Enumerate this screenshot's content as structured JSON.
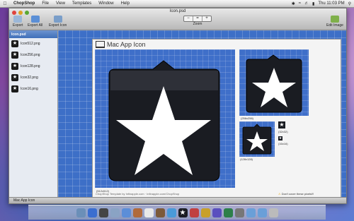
{
  "menubar": {
    "app_name": "ChopShop",
    "items": [
      "File",
      "View",
      "Templates",
      "Window",
      "Help"
    ],
    "clock": "Thu 11:03 PM"
  },
  "window": {
    "title": "Icon.psd",
    "toolbar": {
      "export": "Export",
      "export_all": "Export All",
      "export_icon": "Export Icon",
      "zoom_label": "Zoom",
      "zoom_minus": "−",
      "zoom_fit": "=",
      "zoom_plus": "+",
      "edit_image": "Edit Image"
    }
  },
  "sidebar": {
    "items": [
      {
        "label": "Icon.psd",
        "selected": true
      },
      {
        "label": "Icon512.png"
      },
      {
        "label": "Icon256.png"
      },
      {
        "label": "Icon128.png"
      },
      {
        "label": "Icon32.png"
      },
      {
        "label": "Icon16.png"
      }
    ]
  },
  "sheet": {
    "title": "Mac App Icon",
    "captions": {
      "c512": "(512x512)",
      "c256": "(256x256)",
      "c128": "(128x128)",
      "c32": "(32x32)",
      "c16": "(16x16)"
    },
    "footer_note": "ChopShop Template by Infinapple.com · Infinapple.com/ChopShop",
    "warning": "Don't cover these pixels!!!"
  },
  "statusbar": {
    "text": "Mac App Icon"
  },
  "colors": {
    "blueprint": "#3d6fc7",
    "icon_body": "#1a1c22",
    "selection": "#4f7cc3"
  }
}
